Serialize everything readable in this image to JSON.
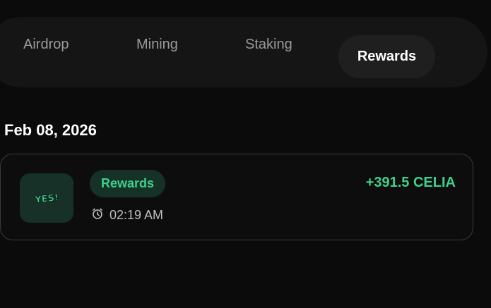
{
  "tabs": [
    {
      "label": "Airdrop"
    },
    {
      "label": "Mining"
    },
    {
      "label": "Staking"
    },
    {
      "label": "Rewards",
      "active": true
    }
  ],
  "group": {
    "date": "Feb 08, 2026",
    "transactions": [
      {
        "logo_text": "YES!",
        "type_badge": "Rewards",
        "time": "02:19 AM",
        "amount": "+391.5 CELIA"
      }
    ]
  },
  "colors": {
    "accent_green": "#3ecf8e",
    "badge_bg": "#163226",
    "logo_bg": "#173028"
  },
  "icons": {
    "time": "alarm-clock-icon"
  }
}
